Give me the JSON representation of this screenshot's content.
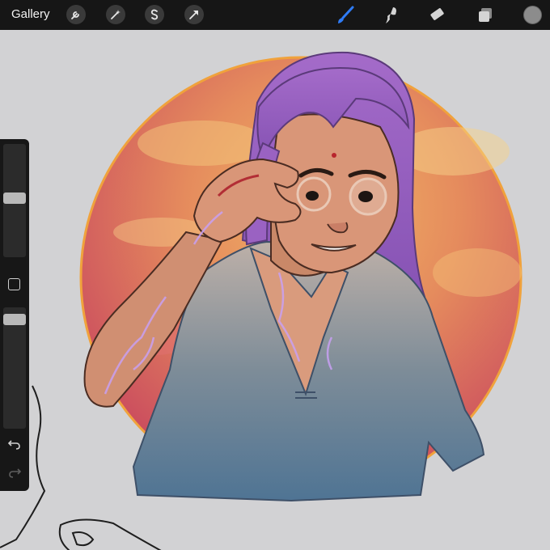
{
  "toolbar": {
    "gallery_label": "Gallery",
    "left_tools": [
      "wrench-icon",
      "magic-wand-icon",
      "selection-s-icon",
      "transform-arrow-icon"
    ],
    "right_tools": [
      "brush-icon",
      "smudge-icon",
      "eraser-icon",
      "layers-icon"
    ],
    "active_tool": "brush-icon",
    "current_color": "#8c8c8c",
    "accent_color": "#2f7cf6"
  },
  "sidebar": {
    "brush_size_level": 0.45,
    "opacity_level": 0.08,
    "controls": [
      "modify-button",
      "undo-icon",
      "redo-icon"
    ]
  }
}
